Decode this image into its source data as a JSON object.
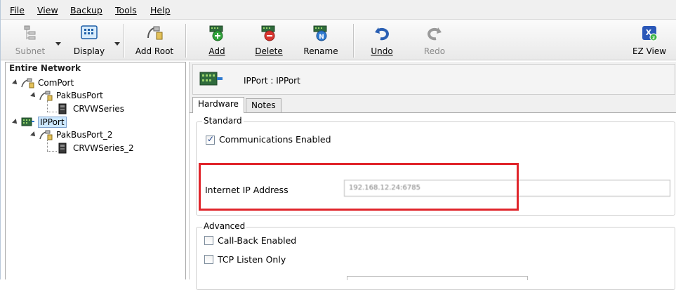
{
  "menu": {
    "file": "File",
    "view": "View",
    "backup": "Backup",
    "tools": "Tools",
    "help": "Help"
  },
  "toolbar": {
    "subnet": "Subnet",
    "display": "Display",
    "add_root": "Add Root",
    "add": "Add",
    "delete": "Delete",
    "rename": "Rename",
    "undo": "Undo",
    "redo": "Redo",
    "ez_view": "EZ View"
  },
  "tree": {
    "header": "Entire Network",
    "items": [
      {
        "label": "ComPort",
        "icon": "comport-icon"
      },
      {
        "label": "PakBusPort",
        "icon": "pakbus-icon"
      },
      {
        "label": "CRVWSeries",
        "icon": "datalogger-icon"
      },
      {
        "label": "IPPort",
        "icon": "ipport-icon",
        "selected": true
      },
      {
        "label": "PakBusPort_2",
        "icon": "pakbus-icon"
      },
      {
        "label": "CRVWSeries_2",
        "icon": "datalogger-icon"
      }
    ]
  },
  "detail": {
    "title": "IPPort : IPPort",
    "tabs": [
      "Hardware",
      "Notes"
    ],
    "active_tab": "Hardware",
    "standard": {
      "label": "Standard",
      "comm_enabled_label": "Communications Enabled",
      "comm_enabled": true,
      "ip_label": "Internet IP Address",
      "ip_value": "192.168.12.24:6785"
    },
    "advanced": {
      "label": "Advanced",
      "callback_label": "Call-Back Enabled",
      "callback": false,
      "tcp_listen_label": "TCP Listen Only",
      "tcp_listen": false
    }
  },
  "colors": {
    "highlight": "#e0252b",
    "selection": "#cde8ff"
  }
}
